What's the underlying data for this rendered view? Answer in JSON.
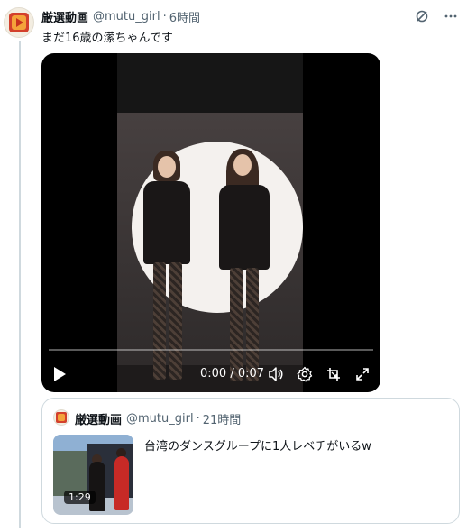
{
  "post": {
    "display_name": "厳選動画",
    "handle": "@mutu_girl",
    "separator": "·",
    "time": "6時間",
    "text": "まだ16歳の潆ちゃんです",
    "icons": {
      "grok": "grok-icon",
      "more": "more-icon"
    }
  },
  "video": {
    "timecode": "0:00 / 0:07",
    "progress": 0.0,
    "accent": "#1d9bf0",
    "icons": [
      "play-icon",
      "volume-icon",
      "settings-icon",
      "pip-icon",
      "fullscreen-icon"
    ]
  },
  "quote": {
    "display_name": "厳選動画",
    "handle": "@mutu_girl",
    "separator": "·",
    "time": "21時間",
    "text": "台湾のダンスグループに1人レベチがいるw",
    "duration": "1:29"
  }
}
